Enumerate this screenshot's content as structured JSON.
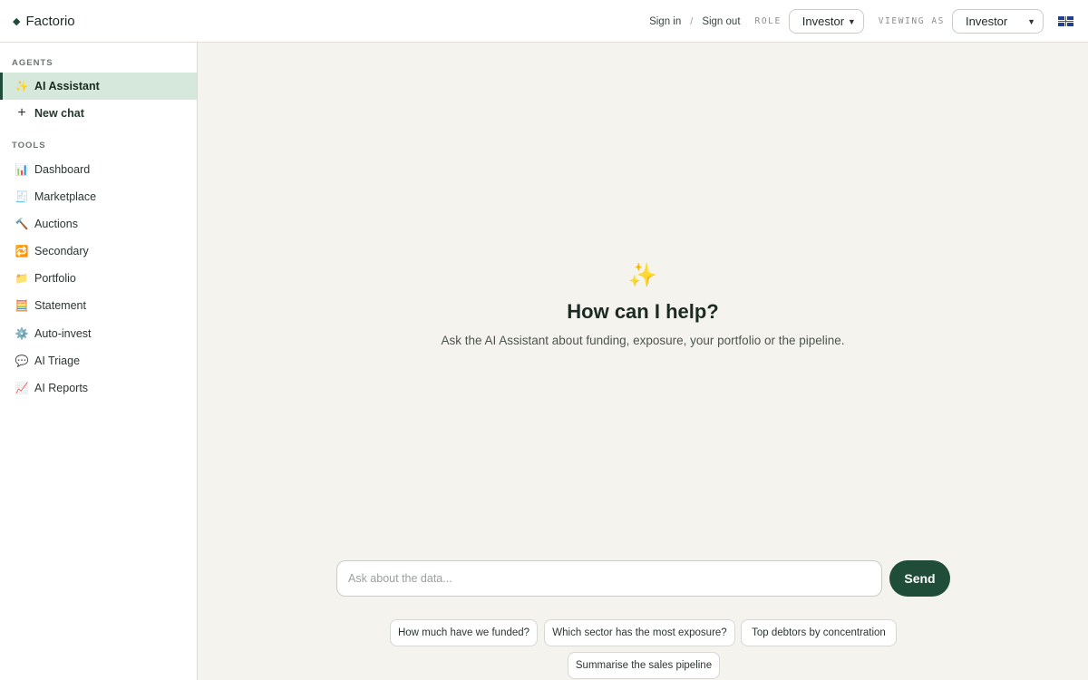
{
  "brand": {
    "name": "Factorio",
    "mark": "◆"
  },
  "header": {
    "sign_in": "Sign in",
    "separator": "/",
    "sign_out": "Sign out",
    "role_label": "ROLE",
    "role_value": "Investor",
    "viewing_label": "VIEWING AS",
    "viewing_value": "Investor",
    "language_icon": "uk-flag-icon"
  },
  "sidebar": {
    "agents_label": "AGENTS",
    "agents": [
      {
        "icon": "✨",
        "icon_name": "sparkles-icon",
        "label": "AI Assistant",
        "active": true
      },
      {
        "icon": "+",
        "icon_name": "plus-icon",
        "label": "New chat"
      }
    ],
    "tools_label": "TOOLS",
    "tools": [
      {
        "icon": "📊",
        "icon_name": "bar-chart-icon",
        "label": "Dashboard"
      },
      {
        "icon": "🧾",
        "icon_name": "receipt-icon",
        "label": "Marketplace"
      },
      {
        "icon": "🔨",
        "icon_name": "hammer-icon",
        "label": "Auctions"
      },
      {
        "icon": "🔁",
        "icon_name": "repeat-icon",
        "label": "Secondary"
      },
      {
        "icon": "📁",
        "icon_name": "folder-icon",
        "label": "Portfolio"
      },
      {
        "icon": "🧮",
        "icon_name": "abacus-icon",
        "label": "Statement"
      },
      {
        "icon": "⚙️",
        "icon_name": "gear-icon",
        "label": "Auto-invest"
      },
      {
        "icon": "💬",
        "icon_name": "speech-bubble-icon",
        "label": "AI Triage"
      },
      {
        "icon": "📈",
        "icon_name": "line-chart-icon",
        "label": "AI Reports"
      }
    ]
  },
  "main": {
    "hero_icon": "✨",
    "title": "How can I help?",
    "subtitle": "Ask the AI Assistant about funding, exposure, your portfolio or the pipeline.",
    "input_placeholder": "Ask about the data...",
    "send_label": "Send",
    "suggestions": [
      "How much have we funded?",
      "Which sector has the most exposure?",
      "Top debtors by concentration",
      "Summarise the sales pipeline"
    ]
  },
  "colors": {
    "accent": "#1f4d3a",
    "active_nav_bg": "#d6e8dc",
    "page_bg": "#f5f3ee",
    "sparkle": "#e6b422"
  }
}
